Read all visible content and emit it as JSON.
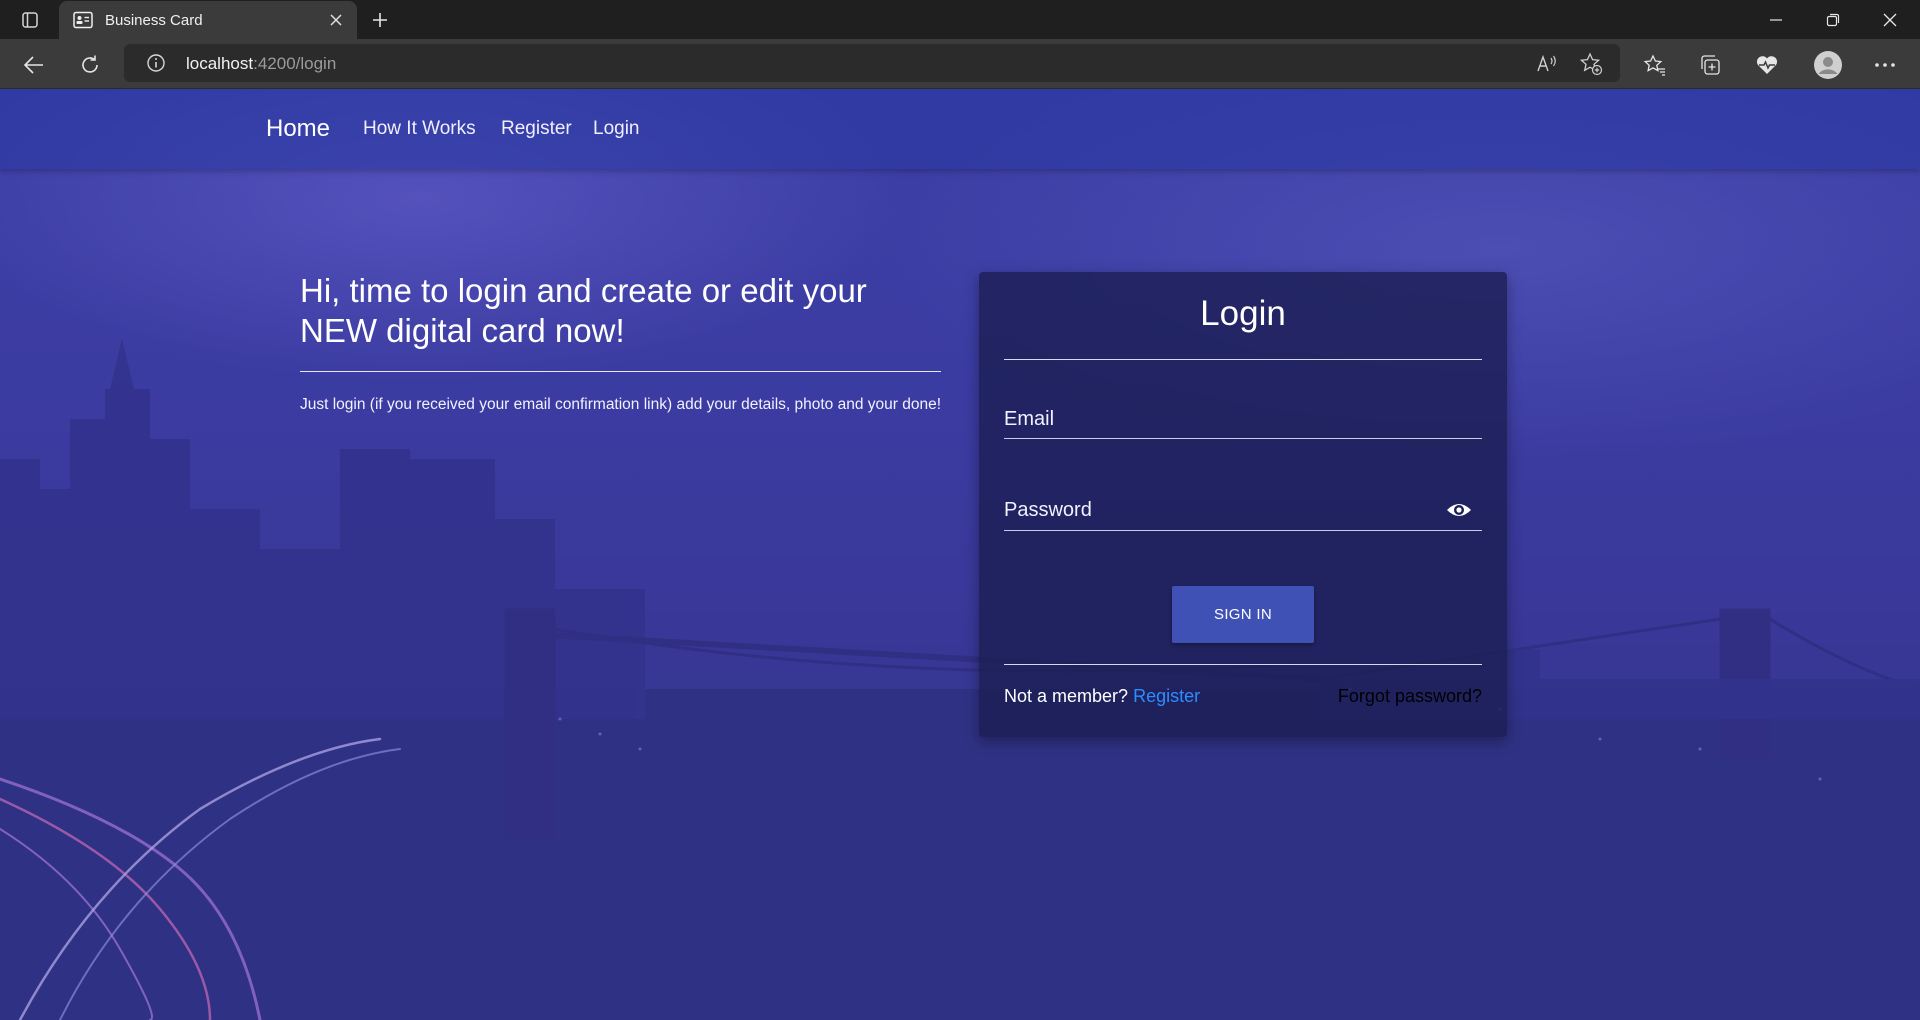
{
  "browser": {
    "tab_title": "Business Card",
    "url_host": "localhost",
    "url_path": ":4200/login"
  },
  "site_nav": {
    "brand": "Home",
    "links": [
      "How It Works",
      "Register",
      "Login"
    ]
  },
  "hero": {
    "title": "Hi, time to login and create or edit your NEW digital card now!",
    "text": "Just login (if you received your email confirmation link) add your details, photo and your done!"
  },
  "login_card": {
    "title": "Login",
    "email_placeholder": "Email",
    "password_placeholder": "Password",
    "sign_in_label": "SIGN IN",
    "not_member_text": "Not a member?",
    "register_link": "Register",
    "forgot_link": "Forgot password?"
  },
  "colors": {
    "primary_button": "#3f51b5",
    "link": "#2f8cff"
  },
  "icons": [
    "tab-actions-icon",
    "business-card-favicon",
    "close-icon",
    "plus-icon",
    "minimize-icon",
    "restore-icon",
    "window-close-icon",
    "back-arrow-icon",
    "refresh-icon",
    "info-icon",
    "read-aloud-icon",
    "add-favorite-icon",
    "favorites-icon",
    "collections-icon",
    "browser-essentials-icon",
    "profile-avatar-icon",
    "more-icon",
    "eye-icon"
  ]
}
